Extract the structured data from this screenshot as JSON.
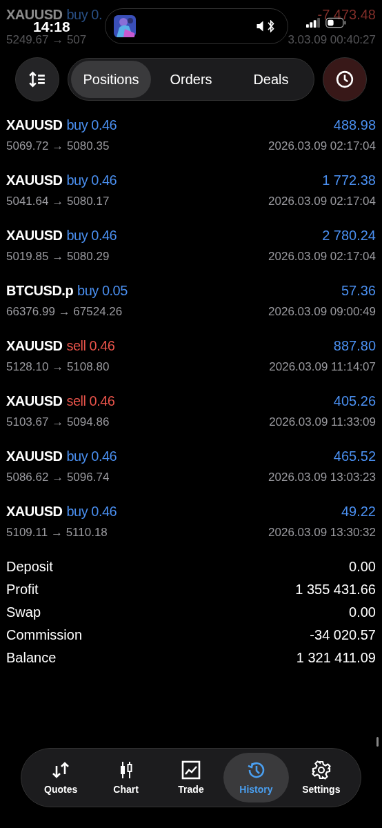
{
  "status_bar": {
    "time": "14:18"
  },
  "nav": {
    "tabs": [
      {
        "label": "Positions",
        "selected": true
      },
      {
        "label": "Orders",
        "selected": false
      },
      {
        "label": "Deals",
        "selected": false
      }
    ]
  },
  "deals": [
    {
      "symbol": "XAUUSD",
      "side": "buy 0.",
      "kind": "buy",
      "profit": "-7 473.48",
      "loss": true,
      "prices": "5249.67 → 507",
      "time": "3.03.09 00:40:27",
      "faded": true
    },
    {
      "symbol": "XAUUSD",
      "side": "buy 0.46",
      "kind": "buy",
      "profit": "488.98",
      "loss": false,
      "prices": "5069.72 → 5080.35",
      "time": "2026.03.09 02:17:04",
      "faded": false
    },
    {
      "symbol": "XAUUSD",
      "side": "buy 0.46",
      "kind": "buy",
      "profit": "1 772.38",
      "loss": false,
      "prices": "5041.64 → 5080.17",
      "time": "2026.03.09 02:17:04",
      "faded": false
    },
    {
      "symbol": "XAUUSD",
      "side": "buy 0.46",
      "kind": "buy",
      "profit": "2 780.24",
      "loss": false,
      "prices": "5019.85 → 5080.29",
      "time": "2026.03.09 02:17:04",
      "faded": false
    },
    {
      "symbol": "BTCUSD.p",
      "side": "buy 0.05",
      "kind": "buy",
      "profit": "57.36",
      "loss": false,
      "prices": "66376.99 → 67524.26",
      "time": "2026.03.09 09:00:49",
      "faded": false
    },
    {
      "symbol": "XAUUSD",
      "side": "sell 0.46",
      "kind": "sell",
      "profit": "887.80",
      "loss": false,
      "prices": "5128.10 → 5108.80",
      "time": "2026.03.09 11:14:07",
      "faded": false
    },
    {
      "symbol": "XAUUSD",
      "side": "sell 0.46",
      "kind": "sell",
      "profit": "405.26",
      "loss": false,
      "prices": "5103.67 → 5094.86",
      "time": "2026.03.09 11:33:09",
      "faded": false
    },
    {
      "symbol": "XAUUSD",
      "side": "buy 0.46",
      "kind": "buy",
      "profit": "465.52",
      "loss": false,
      "prices": "5086.62 → 5096.74",
      "time": "2026.03.09 13:03:23",
      "faded": false
    },
    {
      "symbol": "XAUUSD",
      "side": "buy 0.46",
      "kind": "buy",
      "profit": "49.22",
      "loss": false,
      "prices": "5109.11 → 5110.18",
      "time": "2026.03.09 13:30:32",
      "faded": false
    }
  ],
  "summary": [
    {
      "label": "Deposit",
      "value": "0.00"
    },
    {
      "label": "Profit",
      "value": "1 355 431.66"
    },
    {
      "label": "Swap",
      "value": "0.00"
    },
    {
      "label": "Commission",
      "value": "-34 020.57"
    },
    {
      "label": "Balance",
      "value": "1 321 411.09"
    }
  ],
  "tab_bar": [
    {
      "label": "Quotes",
      "kind": "quotes",
      "selected": false
    },
    {
      "label": "Chart",
      "kind": "chart",
      "selected": false
    },
    {
      "label": "Trade",
      "kind": "trade",
      "selected": false
    },
    {
      "label": "History",
      "kind": "history",
      "selected": true
    },
    {
      "label": "Settings",
      "kind": "settings",
      "selected": false
    }
  ]
}
